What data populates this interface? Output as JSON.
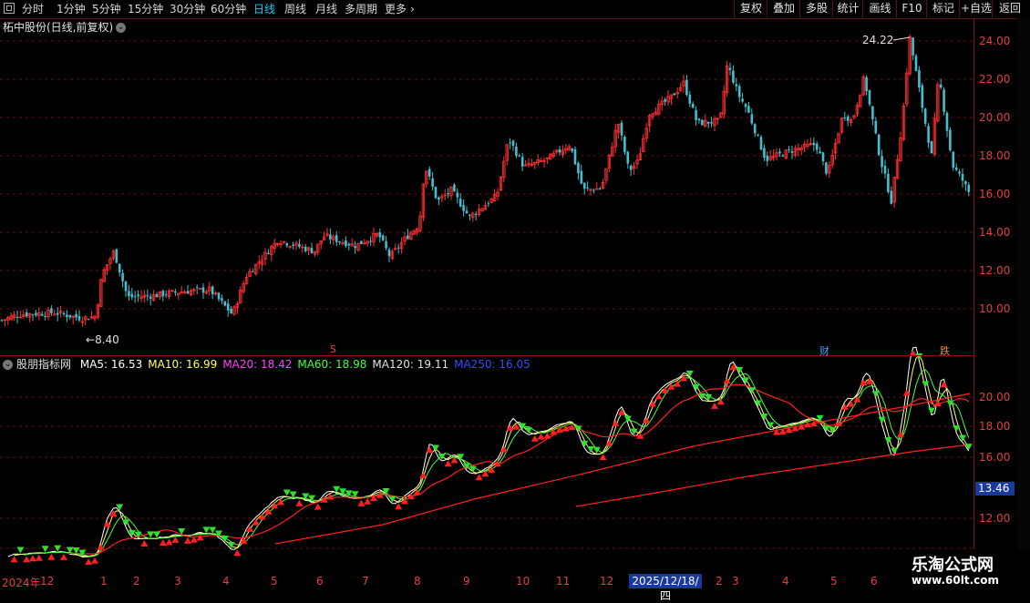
{
  "toolbar": {
    "periods": [
      {
        "label": "分时",
        "active": false
      },
      {
        "label": "1分钟",
        "active": false
      },
      {
        "label": "5分钟",
        "active": false
      },
      {
        "label": "15分钟",
        "active": false
      },
      {
        "label": "30分钟",
        "active": false
      },
      {
        "label": "60分钟",
        "active": false
      },
      {
        "label": "日线",
        "active": true
      },
      {
        "label": "周线",
        "active": false
      },
      {
        "label": "月线",
        "active": false
      },
      {
        "label": "多周期",
        "active": false
      },
      {
        "label": "更多",
        "active": false
      }
    ],
    "right_buttons": [
      "复权",
      "叠加",
      "多股",
      "统计",
      "画线",
      "F10",
      "标记",
      "+自选",
      "返回"
    ]
  },
  "stock": {
    "title": "柘中股份(日线,前复权)"
  },
  "price_panel": {
    "y_ticks": [
      "24.00",
      "22.00",
      "20.00",
      "18.00",
      "16.00",
      "14.00",
      "12.00",
      "10.00"
    ],
    "max_label": "24.22",
    "min_label": "8.40",
    "markers": [
      {
        "text": "S",
        "color": "#ff4040"
      },
      {
        "text": "财",
        "color": "#40a0ff"
      },
      {
        "text": "跌",
        "color": "#ff8040"
      }
    ]
  },
  "indicator_panel": {
    "name": "股朋指标网",
    "ma": [
      {
        "label": "MA5: 16.53",
        "color": "#ffffff"
      },
      {
        "label": "MA10: 16.99",
        "color": "#ffff60"
      },
      {
        "label": "MA20: 18.42",
        "color": "#ff40ff"
      },
      {
        "label": "MA60: 18.98",
        "color": "#40ff40"
      },
      {
        "label": "MA120: 19.11",
        "color": "#e0e0e0"
      },
      {
        "label": "MA250: 16.05",
        "color": "#3050ff"
      }
    ],
    "y_ticks": [
      "20.00",
      "18.00",
      "16.00",
      "12.00"
    ],
    "current_price": "13.46"
  },
  "x_axis": {
    "labels": [
      "2024年",
      "12",
      "1",
      "2",
      "3",
      "4",
      "5",
      "6",
      "7",
      "8",
      "9",
      "10",
      "11",
      "12",
      "2",
      "3",
      "4",
      "5",
      "6"
    ],
    "cursor_date": "2025/12/18/四"
  },
  "watermark": {
    "line1": "乐淘公式网",
    "line2": "www.60lt.com"
  },
  "colors": {
    "up": "#ff3030",
    "down": "#40c0d0",
    "grid": "#6a0e0e",
    "axis": "#8a1010",
    "ma_red": "#ff2020",
    "ma_green": "#40ff40"
  }
}
